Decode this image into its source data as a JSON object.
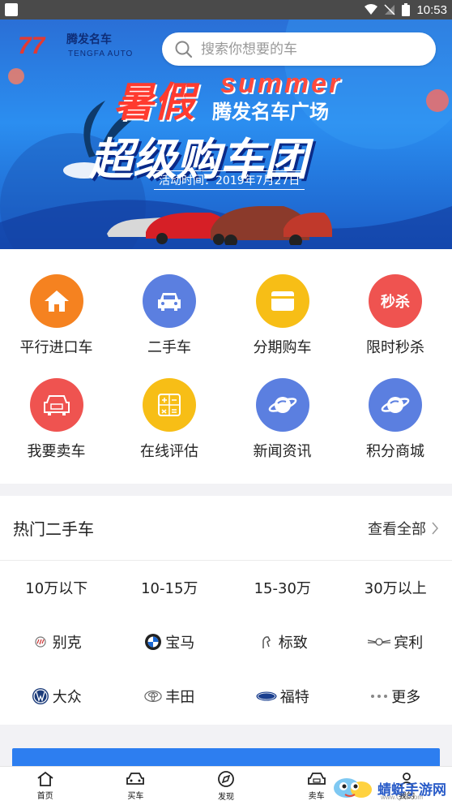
{
  "status_bar": {
    "time": "10:53"
  },
  "banner": {
    "logo_mark": "77",
    "logo_name": "腾发名车",
    "logo_sub": "TENGFA AUTO",
    "headline": "暑假",
    "headline_en": "summer",
    "subtitle": "腾发名车广场",
    "main_title": "超级购车团",
    "date_text": "活动时间：2019年7月27日"
  },
  "search": {
    "placeholder": "搜索你想要的车"
  },
  "categories": [
    {
      "label": "平行进口车",
      "icon": "home-icon",
      "color": "#f58220"
    },
    {
      "label": "二手车",
      "icon": "car-icon",
      "color": "#5b7fe0"
    },
    {
      "label": "分期购车",
      "icon": "card-icon",
      "color": "#f7be16"
    },
    {
      "label": "限时秒杀",
      "icon": "flash-sale-icon",
      "color": "#ef5350",
      "icon_text": "秒杀"
    },
    {
      "label": "我要卖车",
      "icon": "sell-car-icon",
      "color": "#ef5350"
    },
    {
      "label": "在线评估",
      "icon": "calculator-icon",
      "color": "#f7be16"
    },
    {
      "label": "新闻资讯",
      "icon": "planet-icon",
      "color": "#5b7fe0"
    },
    {
      "label": "积分商城",
      "icon": "planet-icon",
      "color": "#5b7fe0"
    }
  ],
  "hot_used": {
    "title": "热门二手车",
    "view_all": "查看全部",
    "price_ranges": [
      "10万以下",
      "10-15万",
      "15-30万",
      "30万以上"
    ],
    "brands_row1": [
      "别克",
      "宝马",
      "标致",
      "宾利"
    ],
    "brands_row2": [
      "大众",
      "丰田",
      "福特",
      "更多"
    ]
  },
  "tabbar": [
    {
      "label": "首页",
      "icon": "home-tab-icon"
    },
    {
      "label": "买车",
      "icon": "buy-car-icon"
    },
    {
      "label": "发现",
      "icon": "discover-icon"
    },
    {
      "label": "卖车",
      "icon": "sell-tab-icon"
    },
    {
      "label": "我的",
      "icon": "profile-icon"
    }
  ],
  "watermark": {
    "text": "蜻蜓手游网",
    "sub": "www.QT6.com"
  }
}
